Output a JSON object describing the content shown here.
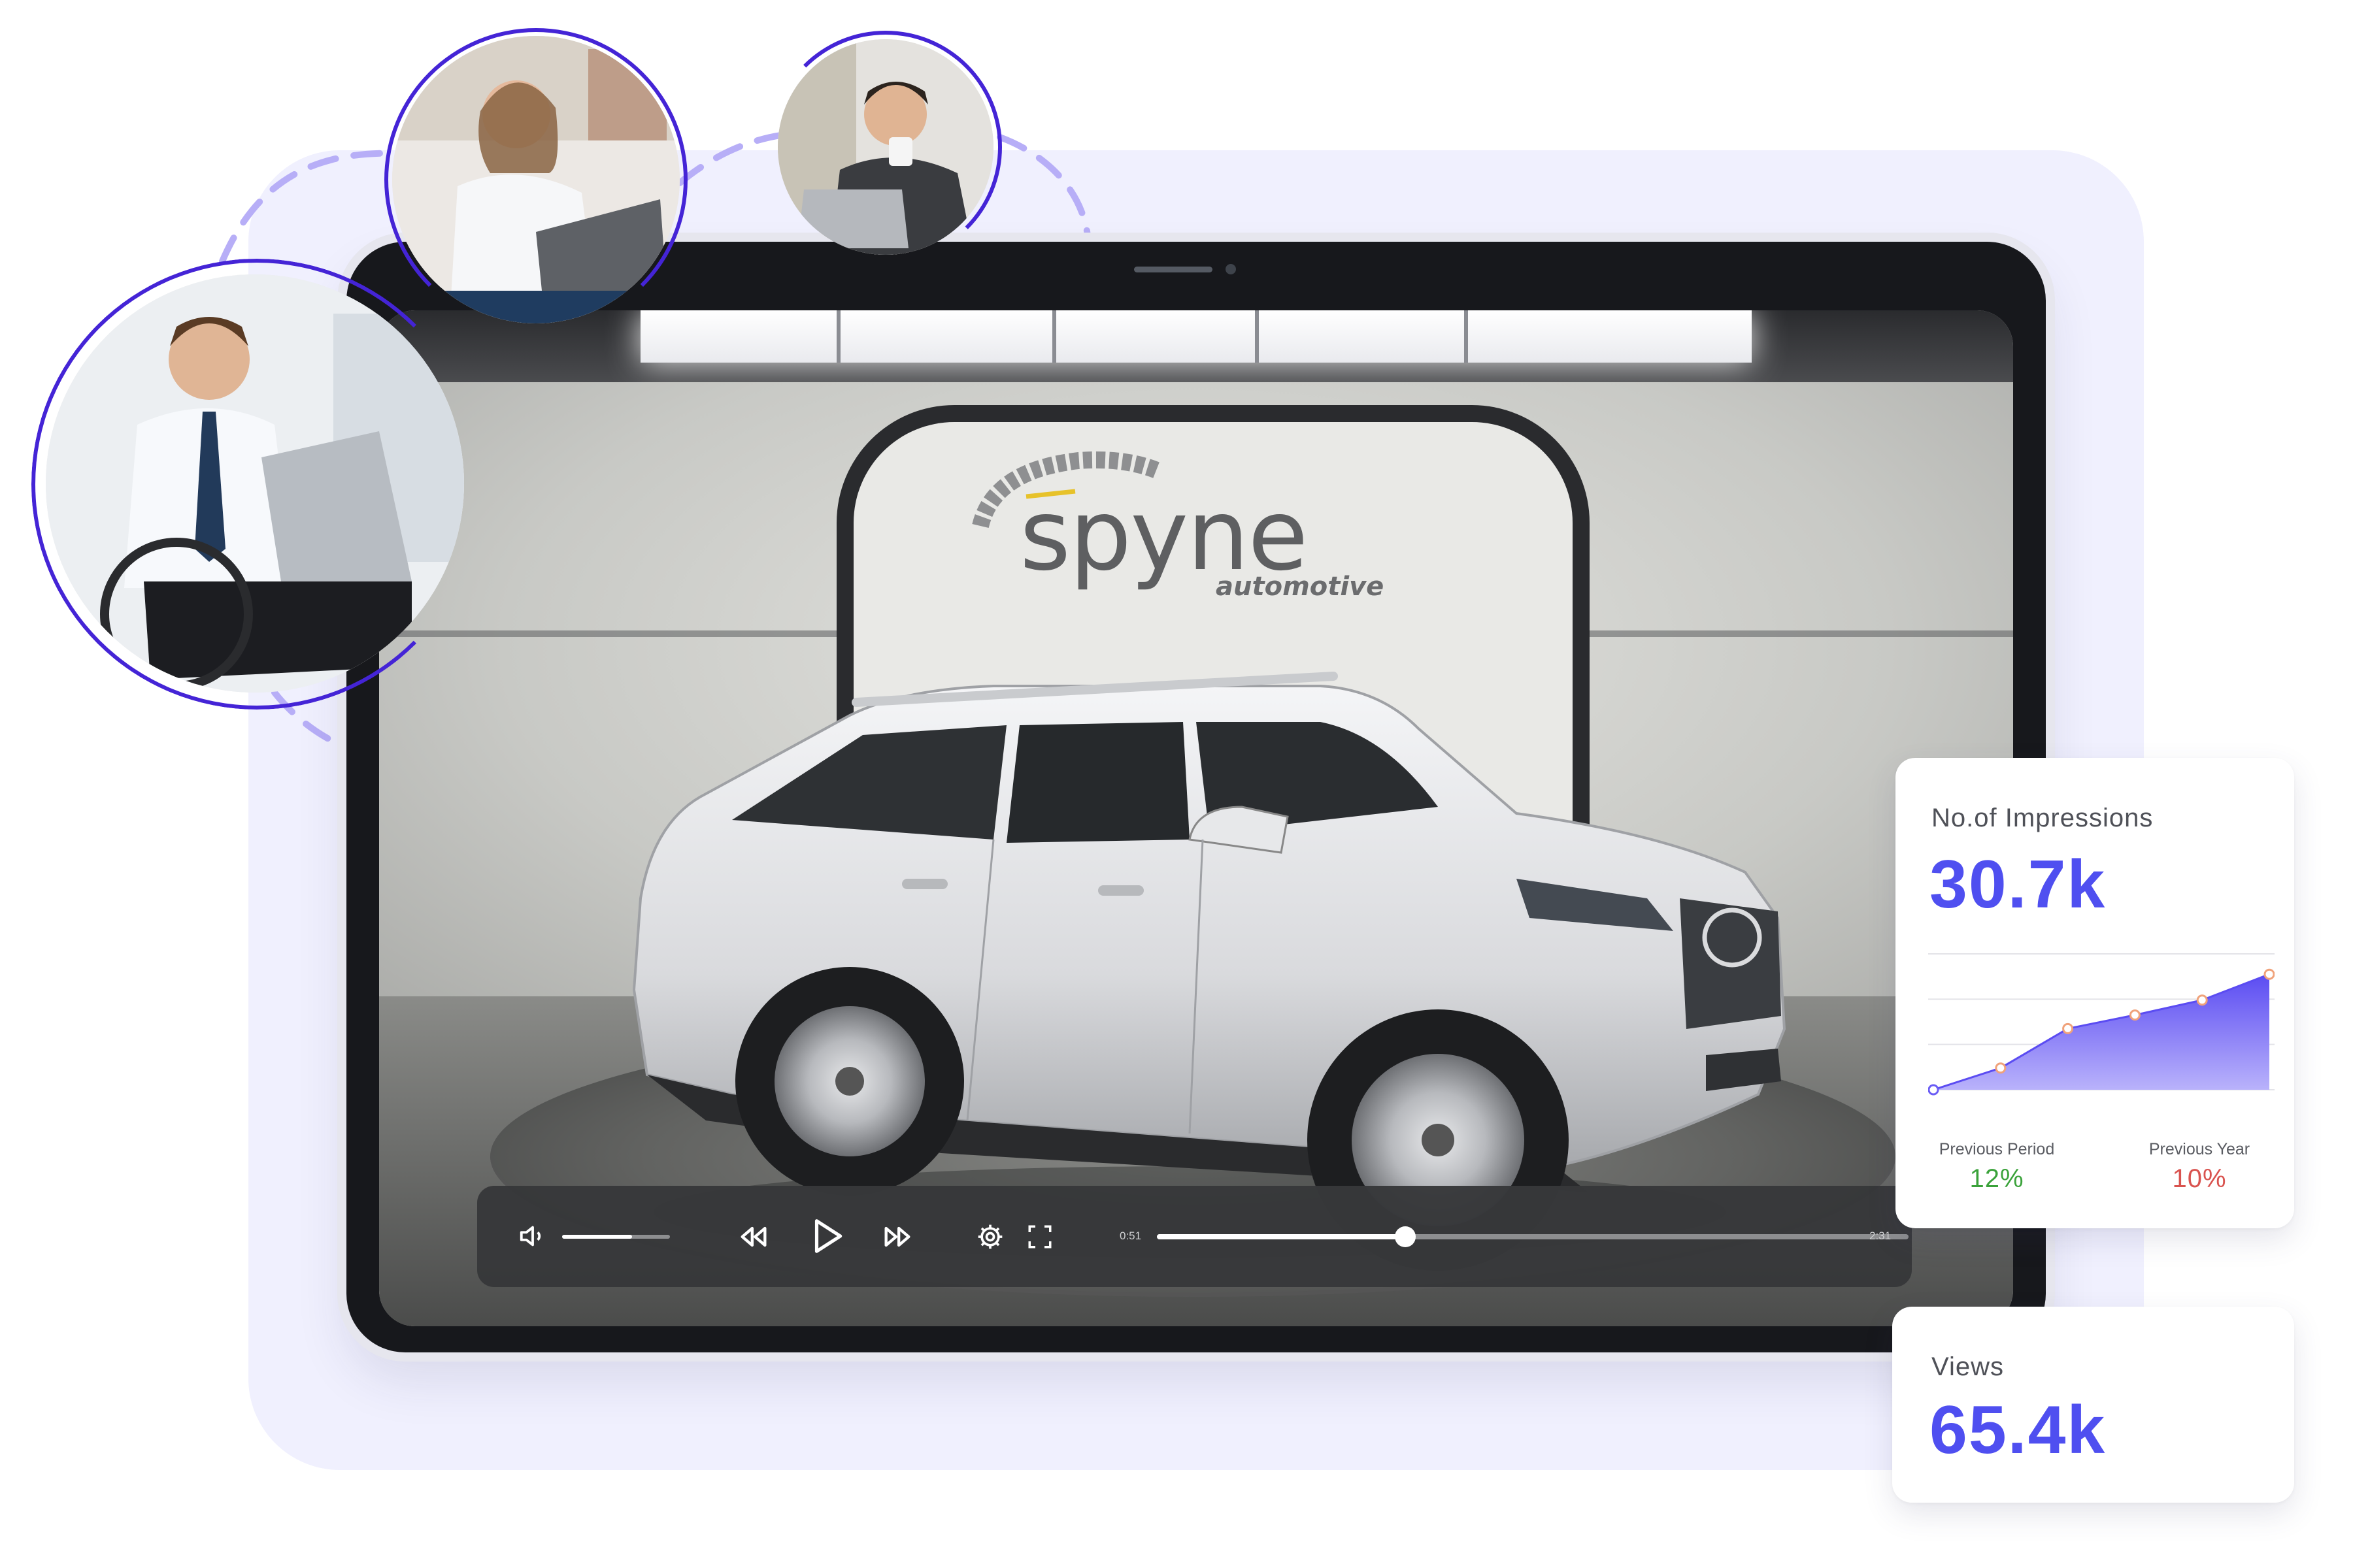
{
  "brand": {
    "name": "spyne",
    "subtitle": "automotive"
  },
  "player": {
    "current_time": "0:51",
    "total_time": "2:31",
    "progress": 0.33,
    "volume": 0.65,
    "icons": [
      "volume-icon",
      "rewind-icon",
      "play-icon",
      "fast-forward-icon",
      "settings-icon",
      "fullscreen-icon"
    ]
  },
  "impressions_card": {
    "label": "No.of Impressions",
    "value": "30.7k",
    "previous_period_label": "Previous Period",
    "previous_period_value": "12%",
    "previous_year_label": "Previous Year",
    "previous_year_value": "10%",
    "colors": {
      "value": "#4f4ff0",
      "positive": "#3aa23a",
      "negative": "#d9534f",
      "area": "#6a5cf5"
    }
  },
  "views_card": {
    "label": "Views",
    "value": "65.4k"
  },
  "chart_data": {
    "type": "area",
    "title": "",
    "xlabel": "",
    "ylabel": "",
    "x": [
      1,
      2,
      3,
      4,
      5,
      6
    ],
    "values": [
      0,
      16,
      45,
      55,
      66,
      85
    ],
    "ylim": [
      0,
      100
    ],
    "grid": true
  }
}
